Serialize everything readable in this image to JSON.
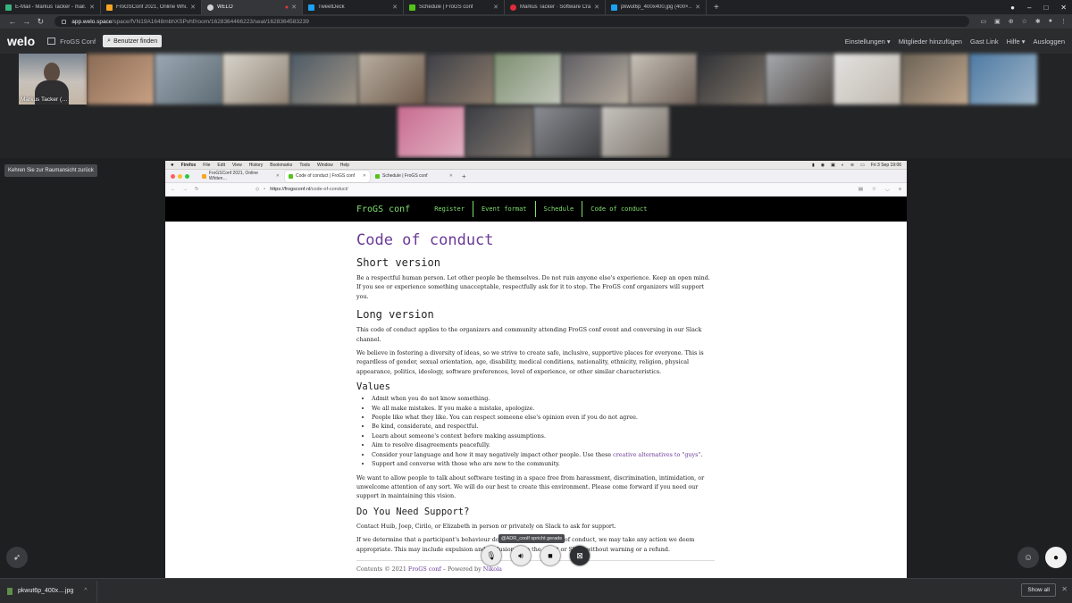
{
  "browser": {
    "tabs": [
      {
        "title": "E-Mail - Markus Tacker - mail…",
        "color": "#36b37e"
      },
      {
        "title": "FroGSConf 2021, Online Whi…",
        "color": "#f5a623"
      },
      {
        "title": "WELO",
        "color": "#cfd2d6"
      },
      {
        "title": "TweetDeck",
        "color": "#1da1f2"
      },
      {
        "title": "Schedule | FroGS conf",
        "color": "#52c41a"
      },
      {
        "title": "Markus Tacker · Software Cra…",
        "color": "#e02c3a"
      },
      {
        "title": "pkwut6p_400x400.jpg (400×…",
        "color": "#1da1f2"
      }
    ],
    "url_host": "app.welo.space",
    "url_path": "/space/fVN19A1648mbhXSPvhf/room/1628364466223/seat/1628364583239"
  },
  "welo": {
    "logo": "welo",
    "space_name": "FroGS Conf",
    "find_members": "Benutzer finden",
    "menu": [
      "Einstellungen",
      "Mitglieder hinzufügen",
      "Gast Link",
      "Hilfe",
      "Ausloggen"
    ],
    "self_name": "Markus Tacker (…",
    "back_to_room": "Kehren Sie zur Raumansicht zurück",
    "speaking": "@ADR_coolf spricht gerade"
  },
  "shared": {
    "mac_menu": [
      "Firefox",
      "File",
      "Edit",
      "View",
      "History",
      "Bookmarks",
      "Tools",
      "Window",
      "Help"
    ],
    "clock": "Fri 3 Sep  19:06",
    "ff_tabs": [
      "FroGSConf 2021, Online Whiten…",
      "Code of conduct | FroGS conf",
      "Schedule | FroGS conf"
    ],
    "ff_url_host": "https://frogsconf.nl",
    "ff_url_path": "/code-of-conduct/",
    "site_brand": "FroGS conf",
    "site_nav": [
      "Register",
      "Event format",
      "Schedule",
      "Code of conduct"
    ],
    "h1": "Code of conduct",
    "short_title": "Short version",
    "short_text": "Be a respectful human person. Let other people be themselves. Do not ruin anyone else's experience. Keep an open mind. If you see or experience something unacceptable, respectfully ask for it to stop. The FroGS conf organizers will support you.",
    "long_title": "Long version",
    "long_p1": "This code of conduct applies to the organizers and community attending FroGS conf event and conversing in our Slack channel.",
    "long_p2": "We believe in fostering a diversity of ideas, so we strive to create safe, inclusive, supportive places for everyone. This is regardless of gender, sexual orientation, age, disability, medical conditions, nationality, ethnicity, religion, physical appearance, politics, ideology, software preferences, level of experience, or other similar characteristics.",
    "values_title": "Values",
    "values": [
      "Admit when you do not know something.",
      "We all make mistakes. If you make a mistake, apologize.",
      "People like what they like. You can respect someone else's opinion even if you do not agree.",
      "Be kind, considerate, and respectful.",
      "Learn about someone's context before making assumptions.",
      "Aim to resolve disagreements peacefully."
    ],
    "value_language_pre": "Consider your language and how it may negatively impact other people. Use these ",
    "value_language_link": "creative alternatives to \"guys\"",
    "value_language_post": ".",
    "value_support": "Support and converse with those who are new to the community.",
    "allow_p": "We want to allow people to talk about software testing in a space free from harassment, discrimination, intimidation, or unwelcome attention of any sort. We will do our best to create this environment. Please come forward if you need our support in maintaining this vision.",
    "support_title": "Do You Need Support?",
    "support_p": "Contact Huib, Joep, Cirilo, or Elizabeth in person or privately on Slack to ask for support.",
    "determine_p1": "If we determine that a participant's behaviour does not follow the code of conduct, we may take any action we deem",
    "determine_p2": "appropriate. This may include expulsion and exclusion from the event or Slack without warning or a refund.",
    "footer_pre": "Contents © 2021 ",
    "footer_link1": "FroGS conf",
    "footer_mid": " – Powered by ",
    "footer_link2": "Nikola"
  },
  "downloads": {
    "file": "pkwut6p_400x....jpg",
    "show_all": "Show all"
  },
  "icons": {
    "mic": "mic-muted-icon",
    "speaker": "speaker-icon",
    "camera": "camera-icon",
    "screen": "screen-share-off-icon",
    "rocket": "rocket-icon",
    "emoji": "emoji-icon",
    "chat": "chat-icon"
  }
}
